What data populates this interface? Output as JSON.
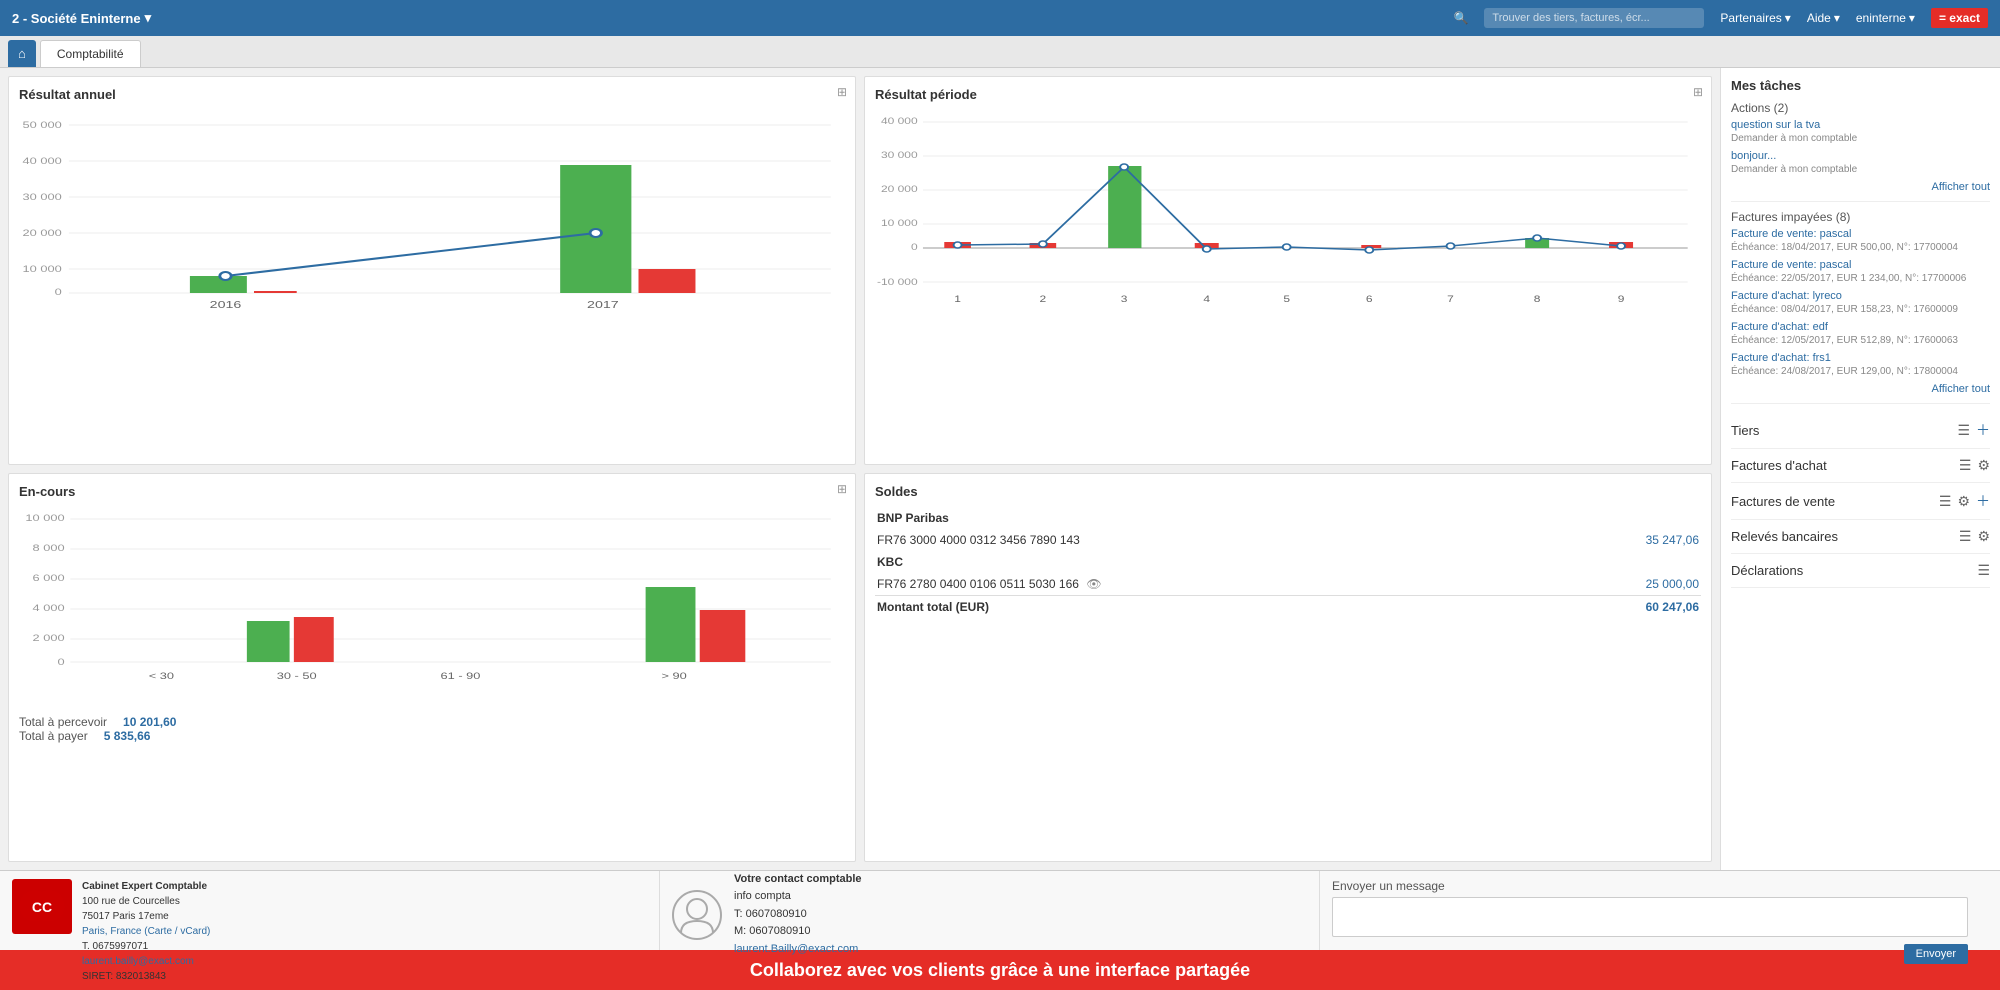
{
  "topnav": {
    "company": "2 - Société Eninterne",
    "search_placeholder": "Trouver des tiers, factures, écr...",
    "partenaires": "Partenaires",
    "aide": "Aide",
    "user": "eninterne",
    "exact_logo": "= exact"
  },
  "tabs": {
    "home_icon": "⌂",
    "comptabilite": "Comptabilité"
  },
  "resultat_annuel": {
    "title": "Résultat annuel",
    "years": [
      "2016",
      "2017"
    ],
    "bars_green": [
      5000,
      38000
    ],
    "bars_red": [
      800,
      7000
    ],
    "line_points": [
      4500,
      20000
    ],
    "y_labels": [
      "50 000",
      "40 000",
      "30 000",
      "20 000",
      "10 000",
      "0"
    ]
  },
  "resultat_periode": {
    "title": "Résultat période",
    "x_labels": [
      "1",
      "2",
      "3",
      "4",
      "5",
      "6",
      "7",
      "8",
      "9"
    ],
    "bars_green": [
      0,
      0,
      30000,
      0,
      0,
      0,
      0,
      1500,
      0
    ],
    "bars_red": [
      1000,
      500,
      0,
      500,
      0,
      200,
      0,
      0,
      1000
    ],
    "line_points": [
      500,
      700,
      30000,
      -500,
      200,
      -200,
      100,
      1500,
      200
    ],
    "y_labels": [
      "40 000",
      "30 000",
      "20 000",
      "10 000",
      "0",
      "-10 000"
    ]
  },
  "encours": {
    "title": "En-cours",
    "x_labels": [
      "< 30",
      "30 - 50",
      "61 - 90",
      "> 90"
    ],
    "bars_green": [
      0,
      2800,
      0,
      5000
    ],
    "bars_red": [
      0,
      3000,
      0,
      3500
    ],
    "y_labels": [
      "10 000",
      "8 000",
      "6 000",
      "4 000",
      "2 000",
      "0"
    ],
    "total_percevoir_label": "Total à percevoir",
    "total_percevoir_value": "10 201,60",
    "total_payer_label": "Total à payer",
    "total_payer_value": "5 835,66"
  },
  "soldes": {
    "title": "Soldes",
    "bnp_name": "BNP Paribas",
    "bnp_iban": "FR76 3000 4000 0312 3456 7890 143",
    "bnp_amount": "35 247,06",
    "kbc_name": "KBC",
    "kbc_iban": "FR76 2780 0400 0106 0511 5030 166",
    "kbc_amount": "25 000,00",
    "total_label": "Montant total (EUR)",
    "total_amount": "60 247,06"
  },
  "taches": {
    "title": "Mes tâches",
    "actions_header": "Actions (2)",
    "action1_title": "question sur la tva",
    "action1_sub": "Demander à mon comptable",
    "action2_title": "bonjour...",
    "action2_sub": "Demander à mon comptable",
    "afficher_tout1": "Afficher tout",
    "factures_header": "Factures impayées (8)",
    "facture1_title": "Facture de vente: pascal",
    "facture1_sub": "Échéance: 18/04/2017, EUR 500,00, N°: 17700004",
    "facture2_title": "Facture de vente: pascal",
    "facture2_sub": "Échéance: 22/05/2017, EUR 1 234,00, N°: 17700006",
    "facture3_title": "Facture d'achat: lyreco",
    "facture3_sub": "Échéance: 08/04/2017, EUR 158,23, N°: 17600009",
    "facture4_title": "Facture d'achat: edf",
    "facture4_sub": "Échéance: 12/05/2017, EUR 512,89, N°: 17600063",
    "facture5_title": "Facture d'achat: frs1",
    "facture5_sub": "Échéance: 24/08/2017, EUR 129,00, N°: 17800004",
    "afficher_tout2": "Afficher tout",
    "tiers": "Tiers",
    "factures_achat": "Factures d'achat",
    "factures_vente": "Factures de vente",
    "releves_bancaires": "Relevés bancaires",
    "declarations": "Déclarations"
  },
  "footer": {
    "section1_title": "Cabinet Expert Comptable",
    "logo_text": "CC",
    "address1": "100 rue de Courcelles",
    "address2": "75017 Paris 17eme",
    "address3": "Paris, France (Carte / vCard)",
    "phone": "T. 0675997071",
    "email": "laurent.bailly@exact.com",
    "siret": "SIRET: 832013843",
    "section2_title": "Votre contact comptable",
    "contact_name": "info compta",
    "contact_phone": "T: 0607080910",
    "contact_mobile": "M: 0607080910",
    "contact_email": "laurent.Bailly@exact.com",
    "section3_title": "Envoyer un message",
    "message_placeholder": "",
    "send_button": "Envoyer"
  },
  "banner": {
    "text": "Collaborez avec vos clients grâce à une interface partagée"
  }
}
